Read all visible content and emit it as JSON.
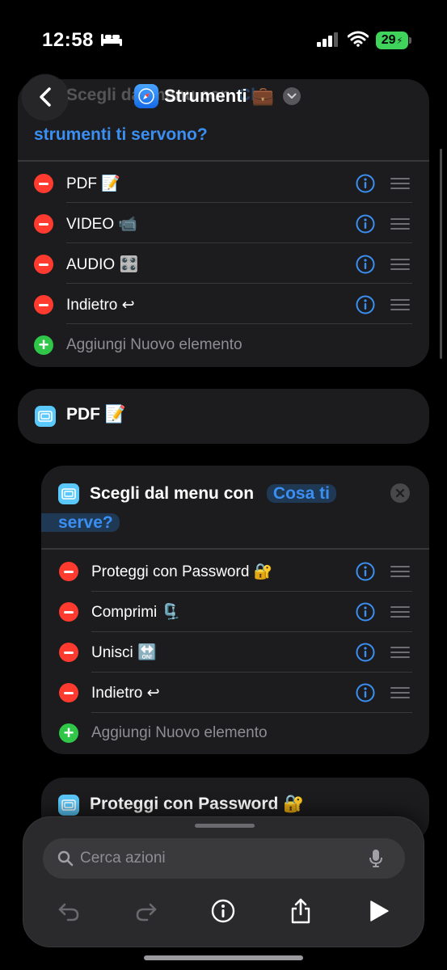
{
  "status": {
    "time": "12:58",
    "battery": "29"
  },
  "nav": {
    "title": "Strumenti 💼"
  },
  "menu1": {
    "prompt_prefix": "Scegli dal menu con",
    "prompt_value_line1": "Che",
    "prompt_value_line2": "strumenti ti servono?",
    "items": [
      {
        "label": "PDF 📝"
      },
      {
        "label": "VIDEO 📹"
      },
      {
        "label": "AUDIO 🎛️"
      },
      {
        "label": "Indietro ↩︎"
      }
    ],
    "add_label": "Aggiungi Nuovo elemento"
  },
  "case1": {
    "label": "PDF 📝"
  },
  "menu2": {
    "prompt_prefix": "Scegli dal menu con",
    "prompt_value_line1": "Cosa ti",
    "prompt_value_line2": "serve?",
    "items": [
      {
        "label": "Proteggi con Password 🔐"
      },
      {
        "label": "Comprimi 🗜️"
      },
      {
        "label": "Unisci 🔛"
      },
      {
        "label": "Indietro ↩︎"
      }
    ],
    "add_label": "Aggiungi Nuovo elemento"
  },
  "action1": {
    "label": "Proteggi con Password 🔐"
  },
  "search": {
    "placeholder": "Cerca azioni"
  },
  "colors": {
    "accent": "#3b8ff2",
    "delete": "#ff3b30",
    "add": "#30c748",
    "card": "#1c1c1e",
    "background": "#000000"
  }
}
